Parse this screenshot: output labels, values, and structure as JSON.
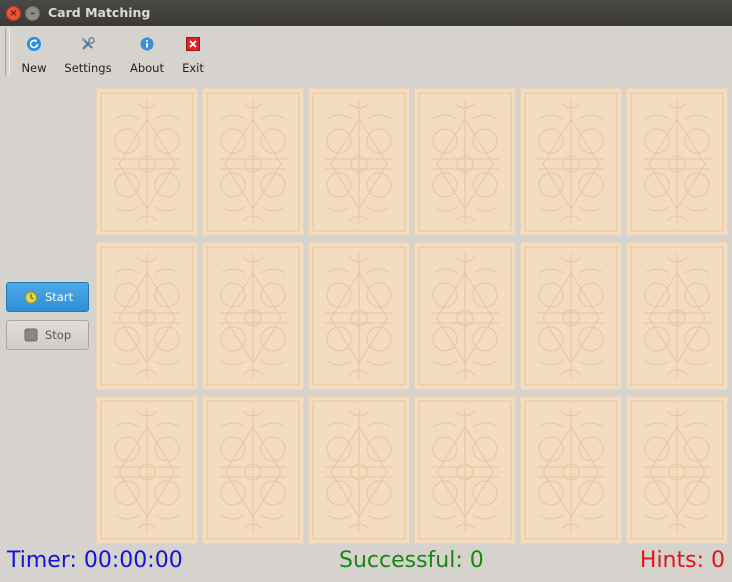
{
  "window": {
    "title": "Card Matching"
  },
  "toolbar": {
    "items": [
      {
        "label": "New",
        "icon": "refresh-icon"
      },
      {
        "label": "Settings",
        "icon": "tools-icon"
      },
      {
        "label": "About",
        "icon": "info-icon"
      },
      {
        "label": "Exit",
        "icon": "exit-icon"
      }
    ]
  },
  "controls": {
    "start_label": "Start",
    "stop_label": "Stop"
  },
  "board": {
    "rows": 3,
    "columns": 6,
    "card_state": "face-down",
    "card_back_color": "#f4dcc0"
  },
  "status": {
    "timer": "Timer: 00:00:00",
    "successful": "Successful: 0",
    "hints": "Hints: 0"
  },
  "colors": {
    "timer": "#1212d9",
    "successful": "#128a12",
    "hints": "#e01515",
    "start_button": "#2b8fd8"
  }
}
